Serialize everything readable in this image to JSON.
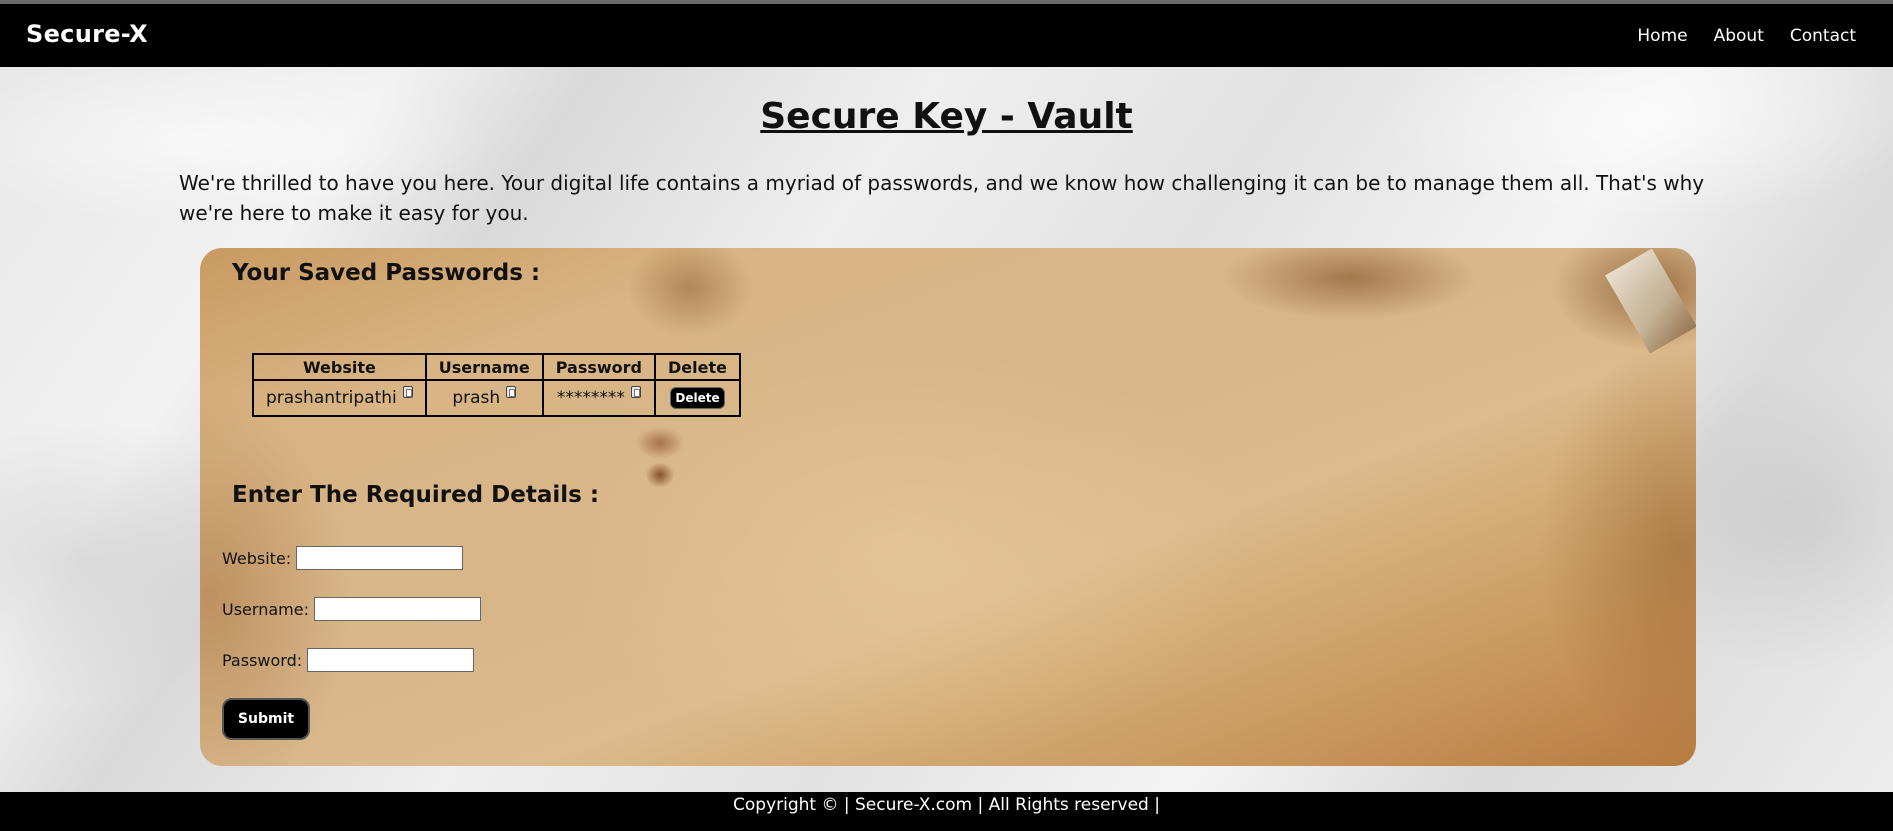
{
  "navbar": {
    "brand": "Secure-X",
    "links": [
      "Home",
      "About",
      "Contact"
    ]
  },
  "main": {
    "title": "Secure Key - Vault",
    "intro": "We're thrilled to have you here. Your digital life contains a myriad of passwords, and we know how challenging it can be to manage them all. That's why we're here to make it easy for you."
  },
  "saved": {
    "heading": "Your Saved Passwords :",
    "columns": [
      "Website",
      "Username",
      "Password",
      "Delete"
    ],
    "rows": [
      {
        "website": "prashantripathi",
        "username": "prash",
        "password": "********",
        "delete_label": "Delete"
      }
    ]
  },
  "form": {
    "heading": "Enter The Required Details :",
    "website_label": "Website:",
    "website_value": "",
    "username_label": "Username:",
    "username_value": "",
    "password_label": "Password:",
    "password_value": "",
    "submit_label": "Submit"
  },
  "footer": {
    "text": "Copyright © | Secure-X.com | All Rights reserved |"
  }
}
